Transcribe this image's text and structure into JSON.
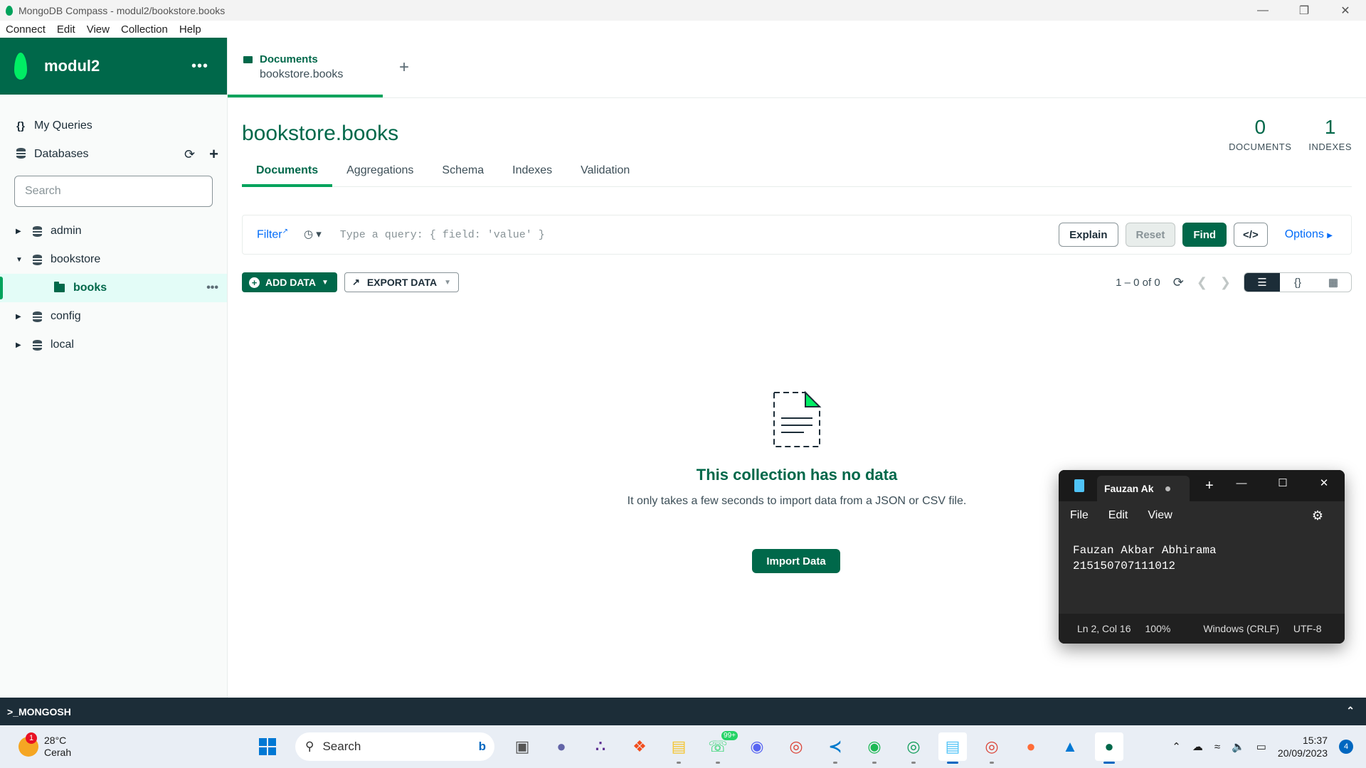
{
  "window": {
    "title": "MongoDB Compass - modul2/bookstore.books"
  },
  "menu": [
    "Connect",
    "Edit",
    "View",
    "Collection",
    "Help"
  ],
  "sidebar": {
    "connection_name": "modul2",
    "my_queries": "My Queries",
    "databases": "Databases",
    "search_placeholder": "Search",
    "tree": [
      {
        "name": "admin",
        "expanded": false
      },
      {
        "name": "bookstore",
        "expanded": true,
        "collections": [
          {
            "name": "books",
            "selected": true
          }
        ]
      },
      {
        "name": "config",
        "expanded": false
      },
      {
        "name": "local",
        "expanded": false
      }
    ]
  },
  "workspace_tab": {
    "title": "Documents",
    "subtitle": "bookstore.books"
  },
  "collection": {
    "db": "bookstore",
    "coll": ".books",
    "documents_count": "0",
    "documents_label": "DOCUMENTS",
    "indexes_count": "1",
    "indexes_label": "INDEXES"
  },
  "collection_tabs": [
    "Documents",
    "Aggregations",
    "Schema",
    "Indexes",
    "Validation"
  ],
  "query_bar": {
    "filter_label": "Filter",
    "placeholder": "Type a query: { field: 'value' }",
    "explain": "Explain",
    "reset": "Reset",
    "find": "Find",
    "options": "Options"
  },
  "toolbar": {
    "add_data": "ADD DATA",
    "export_data": "EXPORT DATA",
    "pagination": "1 – 0 of 0"
  },
  "empty_state": {
    "title": "This collection has no data",
    "subtitle": "It only takes a few seconds to import data from a JSON or CSV file.",
    "import_button": "Import Data"
  },
  "mongosh": {
    "label": ">_MONGOSH"
  },
  "notepad": {
    "tab_title": "Fauzan Ak",
    "menu": [
      "File",
      "Edit",
      "View"
    ],
    "content": "Fauzan Akbar Abhirama\n215150707111012",
    "status": {
      "position": "Ln 2, Col 16",
      "zoom": "100%",
      "line_endings": "Windows (CRLF)",
      "encoding": "UTF-8"
    }
  },
  "taskbar": {
    "weather_temp": "28°C",
    "weather_desc": "Cerah",
    "weather_badge": "1",
    "search_label": "Search",
    "whatsapp_badge": "99+",
    "time": "15:37",
    "date": "20/09/2023",
    "notifications": "4"
  }
}
